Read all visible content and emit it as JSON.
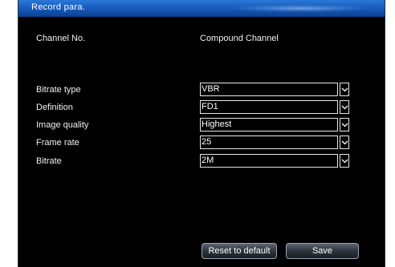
{
  "dialog": {
    "title": "Record para."
  },
  "channel": {
    "label": "Channel No.",
    "value": "Compound Channel"
  },
  "fields": [
    {
      "label": "Bitrate type",
      "value": "VBR"
    },
    {
      "label": "Definition",
      "value": "FD1"
    },
    {
      "label": "Image quality",
      "value": "Highest"
    },
    {
      "label": "Frame rate",
      "value": "25"
    },
    {
      "label": "Bitrate",
      "value": "2M"
    }
  ],
  "buttons": {
    "reset": "Reset  to  default",
    "save": "Save"
  },
  "icons": {
    "dropdown": "chevron-down-icon"
  },
  "colors": {
    "title_bar": "#1557b7",
    "background": "#000000",
    "text": "#f2f2f2"
  }
}
